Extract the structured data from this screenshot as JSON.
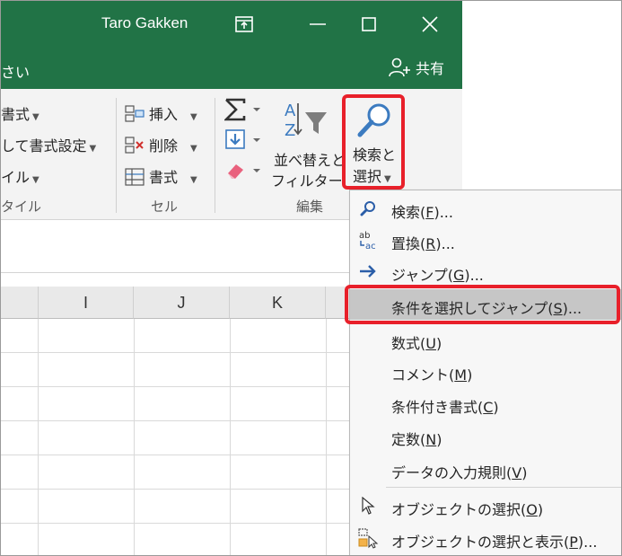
{
  "title_bar": {
    "user_name": "Taro Gakken",
    "colors": {
      "excel_green": "#217346",
      "highlight_red": "#e8202a"
    }
  },
  "tab_row": {
    "tab_fragment": "さい",
    "share_label": "共有"
  },
  "ribbon": {
    "styles_group": {
      "item1": "書式",
      "item2": "して書式設定",
      "item3": "イル",
      "label": "タイル"
    },
    "cells_group": {
      "insert": "挿入",
      "delete": "削除",
      "format": "書式",
      "label": "セル"
    },
    "editing_group": {
      "sort_filter_line1": "並べ替えと",
      "sort_filter_line2": "フィルター",
      "find_select_line1": "検索と",
      "find_select_line2": "選択",
      "label": "編集"
    }
  },
  "sheet": {
    "columns": [
      "I",
      "J",
      "K"
    ]
  },
  "find_menu": {
    "items": [
      {
        "label": "検索(",
        "key": "F",
        "suffix": ")...",
        "icon": "search-icon"
      },
      {
        "label": "置換(",
        "key": "R",
        "suffix": ")...",
        "icon": "replace-icon"
      },
      {
        "label": "ジャンプ(",
        "key": "G",
        "suffix": ")...",
        "icon": "arrow-right-icon"
      },
      {
        "label": "条件を選択してジャンプ(",
        "key": "S",
        "suffix": ")...",
        "highlighted": true
      },
      {
        "label": "数式(",
        "key": "U",
        "suffix": ")"
      },
      {
        "label": "コメント(",
        "key": "M",
        "suffix": ")"
      },
      {
        "label": "条件付き書式(",
        "key": "C",
        "suffix": ")"
      },
      {
        "label": "定数(",
        "key": "N",
        "suffix": ")"
      },
      {
        "label": "データの入力規則(",
        "key": "V",
        "suffix": ")"
      },
      {
        "label": "オブジェクトの選択(",
        "key": "O",
        "suffix": ")",
        "icon": "cursor-arrow-icon"
      },
      {
        "label": "オブジェクトの選択と表示(",
        "key": "P",
        "suffix": ")...",
        "icon": "selection-pane-icon"
      }
    ]
  }
}
